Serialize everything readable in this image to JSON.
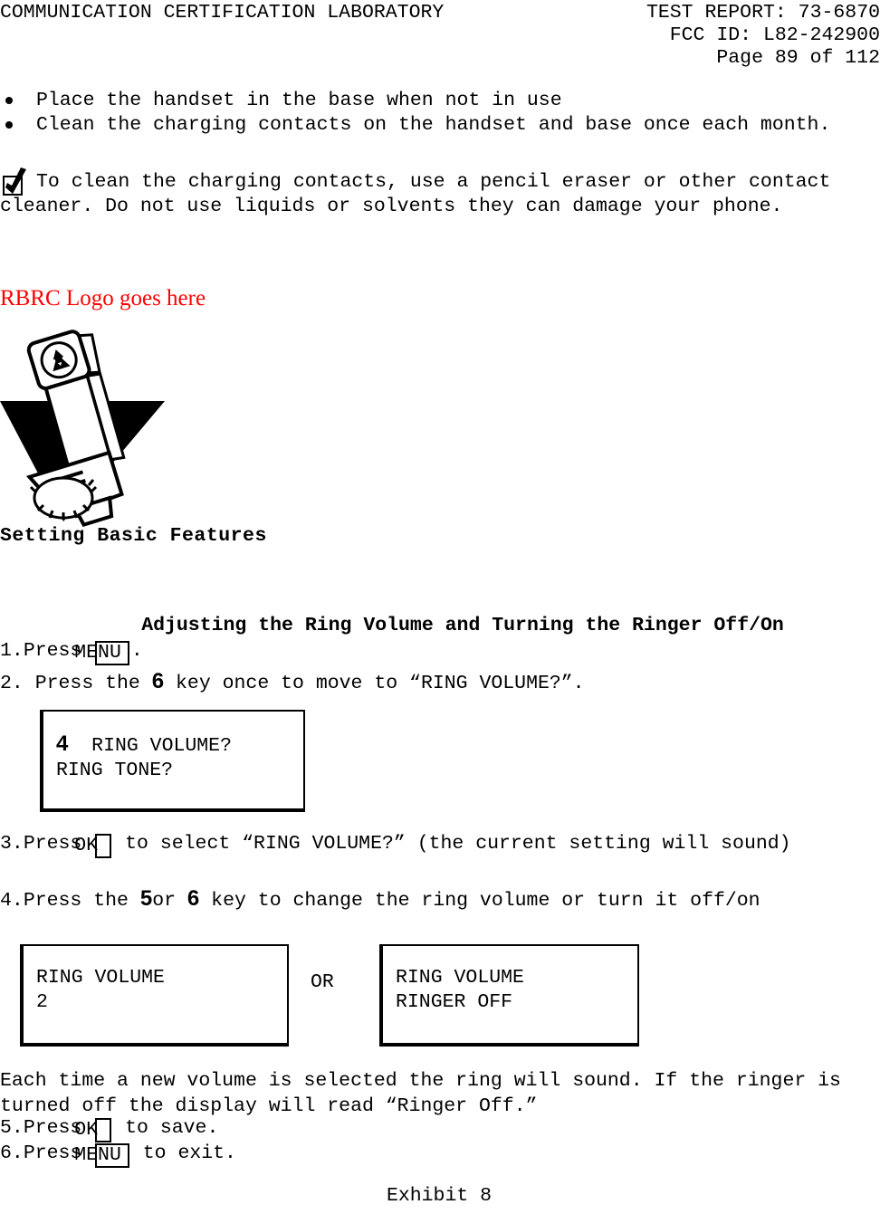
{
  "header": {
    "lab_name": "COMMUNICATION CERTIFICATION LABORATORY",
    "test_report": "TEST REPORT: 73-6870",
    "fcc_id": "FCC ID: L82-242900",
    "page_number": "Page 89 of 112"
  },
  "bullets": [
    "Place the handset in the base when not in use",
    "Clean the charging contacts on the handset and base once each month."
  ],
  "note": {
    "icon": "checkbox-check-icon",
    "text": "To clean the charging contacts, use a pencil eraser or other contact cleaner. Do not use liquids or solvents they can damage your phone."
  },
  "rbrc": {
    "text": "RBRC Logo goes here",
    "color": "#ff0000"
  },
  "clipart": {
    "name": "cordless-handset-battery-recycle-illustration"
  },
  "section": {
    "basic_features_title": "Setting Basic Features",
    "heading": "Adjusting the Ring Volume and Turning the Ringer Off/On"
  },
  "steps": {
    "s1": {
      "number": "1.",
      "pre": "Press ",
      "key": "MENU",
      "post": "."
    },
    "s2": {
      "number": "2.",
      "pre": " Press the ",
      "key": "6",
      "post": " key once to move to “RING VOLUME?”."
    },
    "s3": {
      "number": "3.",
      "pre": "Press ",
      "key": "OK",
      "post": " to select “RING VOLUME?” (the current setting will sound)"
    },
    "s4": {
      "number": "4.",
      "pre": "Press the ",
      "key1": "5",
      "mid": "or ",
      "key2": "6",
      "post": " key to change the ring volume or turn it off/on"
    },
    "s5": {
      "number": "5.",
      "pre": "Press ",
      "key": "OK",
      "post": " to  save."
    },
    "s6": {
      "number": "6.",
      "pre": "Press ",
      "key": "MENU",
      "post": " to exit."
    }
  },
  "tail_note": " Each time a new volume is selected the ring will sound.  If the ringer is turned off the display will read “Ringer Off.”",
  "displays": {
    "menu_display": {
      "num": "4",
      "line1": "  RING VOLUME?",
      "line2": "RING TONE?"
    },
    "or_label": "OR",
    "volume_display": {
      "line1": "RING VOLUME",
      "line2": "2"
    },
    "ringer_off_display": {
      "line1": "RING VOLUME",
      "line2": "RINGER OFF"
    }
  },
  "footer": {
    "exhibit": "Exhibit 8"
  }
}
